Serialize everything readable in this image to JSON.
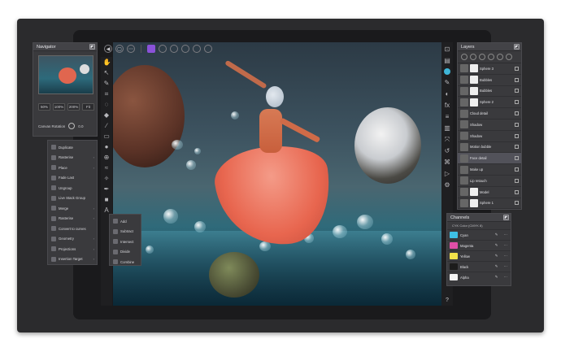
{
  "navigator": {
    "title": "Navigator",
    "zoom_levels": [
      "50%",
      "100%",
      "200%",
      "Fit"
    ],
    "rotation_label": "Canvas Rotation",
    "rotation_value": "0.0"
  },
  "layer_menu": {
    "items": [
      {
        "label": "Duplicate",
        "icon": "duplicate-icon"
      },
      {
        "label": "Rasterise",
        "icon": "rasterise-icon",
        "submenu": true
      },
      {
        "label": "Place",
        "icon": "place-icon",
        "submenu": true
      },
      {
        "label": "Fade Last",
        "icon": "fade-icon"
      },
      {
        "label": "Ungroup",
        "icon": "ungroup-icon"
      },
      {
        "label": "Live Stack Group",
        "icon": "stack-icon"
      },
      {
        "label": "Merge",
        "icon": "merge-icon",
        "submenu": true
      },
      {
        "label": "Rasterise",
        "icon": "rasterise-icon",
        "submenu": true
      },
      {
        "label": "Convert to curves",
        "icon": "curves-icon"
      },
      {
        "label": "Geometry",
        "icon": "geometry-icon",
        "submenu": true
      },
      {
        "label": "Projections",
        "icon": "projection-icon",
        "submenu": true
      },
      {
        "label": "Insertion Target",
        "icon": "target-icon",
        "submenu": true
      }
    ]
  },
  "geometry_menu": {
    "items": [
      "Add",
      "Subtract",
      "Intersect",
      "Divide",
      "Combine"
    ]
  },
  "layers": {
    "title": "Layers",
    "rows": [
      {
        "name": "Sphere 3",
        "mask": true,
        "selected": false
      },
      {
        "name": "Bubbles",
        "mask": true,
        "selected": false
      },
      {
        "name": "Bubbles",
        "mask": true,
        "selected": false
      },
      {
        "name": "Sphere 2",
        "mask": true,
        "selected": false
      },
      {
        "name": "Cloud detail",
        "mask": false,
        "selected": false
      },
      {
        "name": "Shadow",
        "mask": false,
        "selected": false
      },
      {
        "name": "Shadow",
        "mask": false,
        "selected": false
      },
      {
        "name": "Motion bubble",
        "mask": false,
        "selected": false
      },
      {
        "name": "Face detail",
        "mask": false,
        "selected": true
      },
      {
        "name": "Make up",
        "mask": false,
        "selected": false
      },
      {
        "name": "Lip retouch",
        "mask": false,
        "selected": false
      },
      {
        "name": "Model",
        "mask": true,
        "selected": false
      },
      {
        "name": "Sphere 1",
        "mask": true,
        "selected": false
      }
    ]
  },
  "channels": {
    "title": "Channels",
    "subtitle": "CYK Color (CMYK 8)",
    "rows": [
      {
        "name": "Cyan",
        "color": "#3ec1e6"
      },
      {
        "name": "Magenta",
        "color": "#e04fa8"
      },
      {
        "name": "Yellow",
        "color": "#f2e24a"
      },
      {
        "name": "Black",
        "color": "#1c1c1c"
      },
      {
        "name": "Alpha",
        "color": "#f4f4f4"
      }
    ]
  },
  "help_label": "?",
  "accent_color": "#8a52d8"
}
